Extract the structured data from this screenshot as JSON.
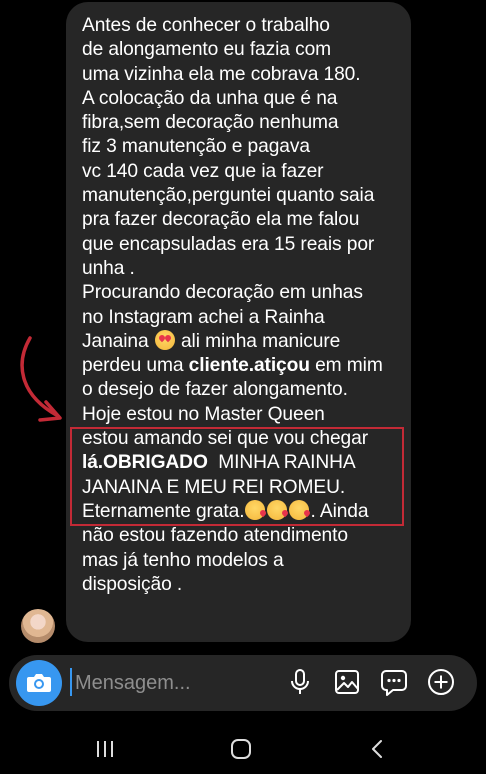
{
  "message": {
    "lines": [
      "Antes de conhecer o trabalho",
      "de alongamento eu fazia com",
      "uma vizinha ela me cobrava 180.",
      "A colocação da unha que é na",
      "fibra,sem decoração nenhuma",
      "fiz 3 manutenção e pagava",
      "vc 140 cada vez que ia fazer",
      "manutenção,perguntei quanto saia",
      "pra fazer decoração ela me falou",
      "que encapsuladas era 15 reais por",
      "unha .",
      "Procurando decoração em unhas",
      "no Instagram achei a Rainha",
      "Janaina",
      " ali minha manicure",
      "perdeu uma ",
      "cliente.atiçou",
      " em mim",
      "o desejo de fazer alongamento.",
      "Hoje estou no Master Queen",
      "estou amando sei que vou chegar",
      "lá.OBRIGADO",
      "  MINHA RAINHA",
      "JANAINA E MEU REI ROMEU.",
      "Eternamente grata.",
      ". Ainda",
      "não estou fazendo atendimento",
      "mas já tenho modelos a",
      "disposição ."
    ]
  },
  "composer": {
    "placeholder": "Mensagem..."
  },
  "colors": {
    "accent": "#3797f0",
    "highlight_border": "#c32a36",
    "bubble": "#262626"
  },
  "icons": [
    "camera-icon",
    "microphone-icon",
    "gallery-icon",
    "sticker-icon",
    "add-icon",
    "recents-icon",
    "home-icon",
    "back-icon"
  ]
}
